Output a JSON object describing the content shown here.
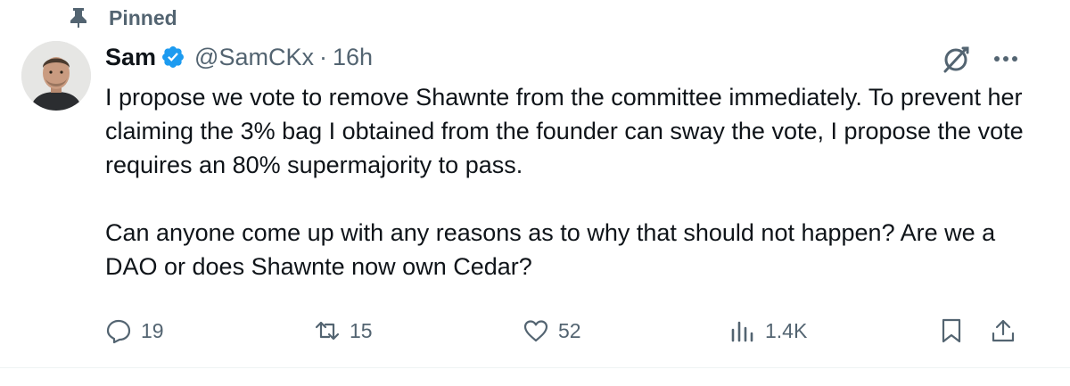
{
  "pinned": {
    "label": "Pinned"
  },
  "author": {
    "name": "Sam",
    "handle": "@SamCKx",
    "separator": "·",
    "time": "16h"
  },
  "tweet": {
    "paragraphs": [
      "I propose we vote to remove Shawnte from the committee immediately. To prevent her claiming the 3% bag I obtained from the founder can sway the vote, I propose the vote requires an 80% supermajority to pass.",
      "Can anyone come up with any reasons as to why that should not happen? Are we a DAO or does Shawnte now own Cedar?"
    ]
  },
  "actions": {
    "replies": "19",
    "reposts": "15",
    "likes": "52",
    "views": "1.4K"
  },
  "colors": {
    "muted": "#536471",
    "verified": "#1d9bf0",
    "text": "#0f1419"
  },
  "icons": [
    "pin-icon",
    "verified-badge-icon",
    "grok-icon",
    "more-icon",
    "reply-icon",
    "repost-icon",
    "like-icon",
    "views-icon",
    "bookmark-icon",
    "share-icon"
  ]
}
